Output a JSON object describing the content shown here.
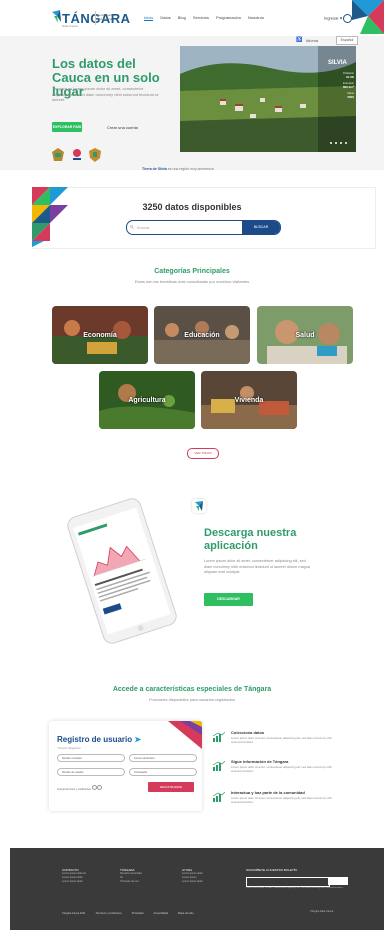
{
  "header": {
    "logo": "TÁNGARA",
    "logo_sub": "Data Cauca",
    "gov_text": "Gobernación del Cauca",
    "nav": [
      "Inicio",
      "Datos",
      "Blog",
      "Servicios",
      "Programación",
      "Nosotros"
    ],
    "login": "Ingresar"
  },
  "hero": {
    "lang_label": "Idioma",
    "lang_value": "Español",
    "title": "Los datos del Cauca en un solo lugar",
    "description": "Tángara es lorem ipsum dolor sit amet, consectetur adipiscing elit, sed diam nonummy nibh euismod tincidunt ut laoreet.",
    "explore_btn": "EXPLORAR PAÍS",
    "create_account": "Crear una cuenta",
    "image_place": "SILVIA",
    "stats": [
      {
        "label": "Población",
        "value": "31.9K"
      },
      {
        "label": "Extensión",
        "value": "662 km²"
      },
      {
        "label": "Altitud",
        "value": "2620"
      }
    ],
    "caption_bold": "Tierra de Silvia",
    "caption_rest": "es una región muy pintoresca"
  },
  "data_band": {
    "title": "3250 datos disponibles",
    "search_placeholder": "Buscar",
    "search_btn": "BUSCAR"
  },
  "categories": {
    "title": "Categorías Principales",
    "subtitle": "Estas son las temáticas más consultadas por nuestros visitantes",
    "items": [
      "Economía",
      "Educación",
      "Salud",
      "Agricultura",
      "Vivienda"
    ],
    "more_btn": "VER TODAS"
  },
  "app": {
    "title": "Descarga nuestra aplicación",
    "description": "Lorem ipsum dolor sit amet, consectetuer adipiscing elit, sed diam nonummy nibh euismod tincidunt ut laoreet dolore magna aliquam erat volutpat.",
    "btn": "DESCARGAR"
  },
  "features": {
    "title": "Accede a características especiales de Tángara",
    "subtitle": "Funciones disponibles para usuarios registrados",
    "register": {
      "title": "Registro de usuario",
      "required": "*Campos obligatorios",
      "fields": [
        "Nombre completo",
        "Correo electrónico",
        "Nombre de usuario",
        "Contraseña"
      ],
      "radio_label": "Acepto términos y condiciones",
      "btn": "REGISTRARME"
    },
    "items": [
      {
        "title": "Colecciona datos",
        "desc": "Lorem ipsum dolor sit amet, consectetuer adipiscing elit, sed diam nonummy nibh euismod tincidunt."
      },
      {
        "title": "Sigue información de Tángara",
        "desc": "Lorem ipsum dolor sit amet, consectetuer adipiscing elit, sed diam nonummy nibh euismod tincidunt."
      },
      {
        "title": "Interactua y haz parte de la comunidad",
        "desc": "Lorem ipsum dolor sit amet, consectetuer adipiscing elit, sed diam nonummy nibh euismod tincidunt."
      }
    ]
  },
  "footer": {
    "cols": [
      {
        "head": "CONTACTO",
        "links": [
          "Lorem ipsum dolor sit",
          "Lorem ipsum dolor",
          "Lorem ipsum dolor"
        ]
      },
      {
        "head": "TÁNGARA",
        "links": [
          "Nuestra comunidad",
          "Ve",
          "Términos de uso"
        ]
      },
      {
        "head": "AYUDA",
        "links": [
          "Lorem ipsum dolor",
          "Lorem ipsum",
          "Lorem ipsum dolor"
        ]
      }
    ],
    "newsletter_head": "SUSCRÍBETE A NUESTRO BOLETÍN",
    "newsletter_text": "Lorem ipsum dolor sit amet, consectetuer adipiscing elit, sed diam nonummy nibh euismod tincidunt.",
    "bottom": [
      "Tángara Cauca 2021",
      "Términos y condiciones",
      "Privacidad",
      "Accesibilidad",
      "Mapa del sitio"
    ],
    "copyright": "Tángara Data Cauca"
  },
  "colors": {
    "green": "#2e9c6a",
    "button_green": "#2fbf63",
    "navy": "#1d4b8a",
    "crimson": "#d63a5a",
    "footer": "#3a3a3a"
  }
}
